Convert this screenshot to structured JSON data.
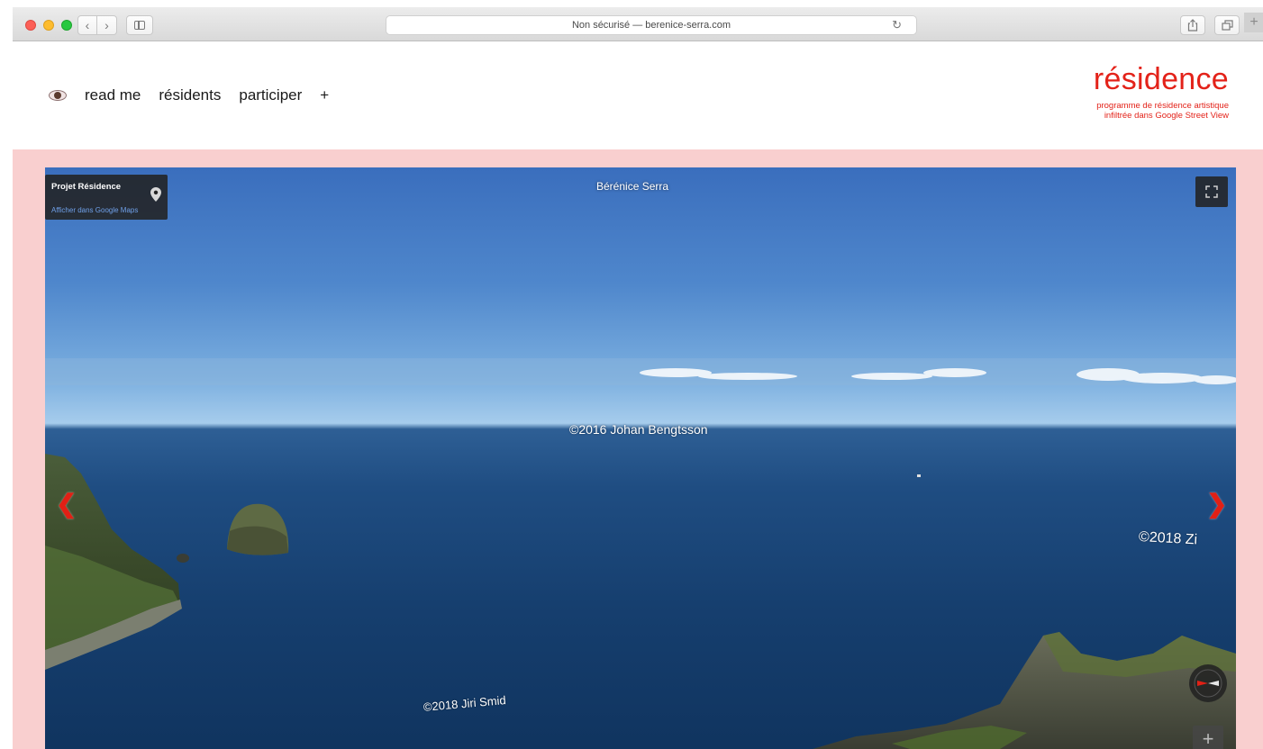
{
  "browser": {
    "address": "Non sécurisé — berenice-serra.com",
    "back_icon": "chevron-left-icon",
    "forward_icon": "chevron-right-icon",
    "reload_glyph": "↻",
    "back_glyph": "‹",
    "forward_glyph": "›",
    "new_tab_glyph": "+"
  },
  "nav": {
    "eye_icon": "eye-icon",
    "items": [
      "read me",
      "résidents",
      "participer",
      "+"
    ]
  },
  "brand": {
    "title": "résidence",
    "subtitle_line1": "programme de résidence artistique",
    "subtitle_line2": "infiltrée dans Google Street View",
    "color": "#e32219"
  },
  "panorama": {
    "infobox_title": "Projet Résidence",
    "infobox_link": "Afficher dans Google Maps",
    "author": "Bérénice Serra",
    "credit_main": "©2016 Johan Bengtsson",
    "credit_bottom": "©2018 Jiri Smid",
    "credit_right": "©2018 Zi",
    "prev_glyph": "❮",
    "next_glyph": "❯",
    "zoom_glyph": "+"
  },
  "colors": {
    "page_background": "#f9cfcf",
    "arrow": "#e12015"
  }
}
